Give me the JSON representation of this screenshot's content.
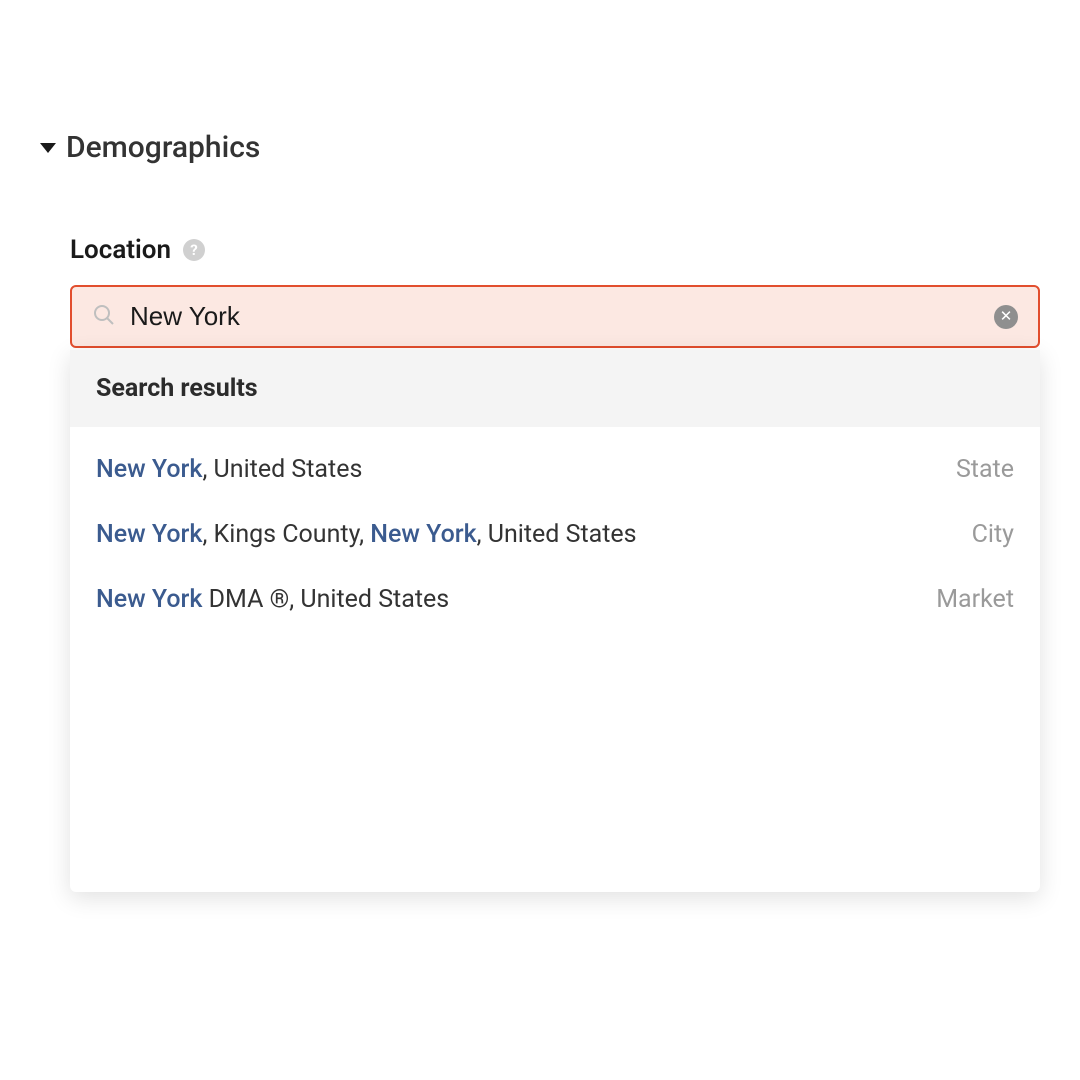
{
  "section": {
    "title": "Demographics"
  },
  "location": {
    "label": "Location",
    "search_value": "New York",
    "search_placeholder": "",
    "results_header": "Search results",
    "results": [
      {
        "segments": [
          {
            "text": "New York",
            "hl": true
          },
          {
            "text": ", United States",
            "hl": false
          }
        ],
        "type": "State"
      },
      {
        "segments": [
          {
            "text": "New York",
            "hl": true
          },
          {
            "text": ", Kings County, ",
            "hl": false
          },
          {
            "text": "New York",
            "hl": true
          },
          {
            "text": ", United States",
            "hl": false
          }
        ],
        "type": "City"
      },
      {
        "segments": [
          {
            "text": "New York",
            "hl": true
          },
          {
            "text": " DMA ®, United States",
            "hl": false
          }
        ],
        "type": "Market"
      }
    ]
  },
  "colors": {
    "accent": "#e24e2e",
    "highlight_bg": "#fce8e2",
    "link_blue": "#3b5b8f",
    "muted": "#9a9a9a"
  }
}
